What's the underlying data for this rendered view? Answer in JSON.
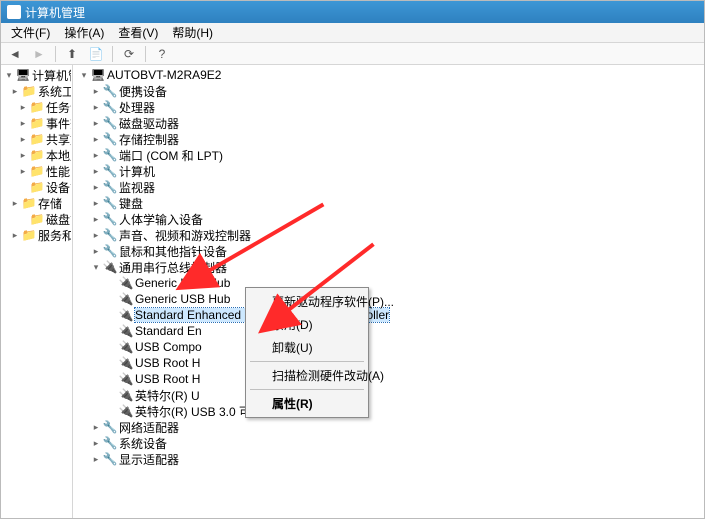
{
  "window": {
    "title": "计算机管理"
  },
  "menu": {
    "file": "文件(F)",
    "action": "操作(A)",
    "view": "查看(V)",
    "help": "帮助(H)"
  },
  "left_tree": {
    "root": "计算机管理(本机",
    "items": [
      "系统工具",
      "任务计划程",
      "事件查看器",
      "共享文件夹",
      "本地用户和",
      "性能",
      "设备管理器",
      "存储",
      "磁盘管理",
      "服务和应用程"
    ]
  },
  "device_tree": {
    "root": "AUTOBVT-M2RA9E2",
    "categories": [
      {
        "label": "便携设备",
        "icon": "portable-device-icon"
      },
      {
        "label": "处理器",
        "icon": "cpu-icon"
      },
      {
        "label": "磁盘驱动器",
        "icon": "disk-icon"
      },
      {
        "label": "存储控制器",
        "icon": "storage-ctrl-icon"
      },
      {
        "label": "端口 (COM 和 LPT)",
        "icon": "port-icon"
      },
      {
        "label": "计算机",
        "icon": "computer-icon"
      },
      {
        "label": "监视器",
        "icon": "monitor-icon"
      },
      {
        "label": "键盘",
        "icon": "keyboard-icon"
      },
      {
        "label": "人体学输入设备",
        "icon": "hid-icon"
      },
      {
        "label": "声音、视频和游戏控制器",
        "icon": "sound-icon"
      },
      {
        "label": "鼠标和其他指针设备",
        "icon": "mouse-icon"
      }
    ],
    "usb_category": "通用串行总线控制器",
    "usb_devices": [
      "Generic USB Hub",
      "Generic USB Hub",
      "Standard Enhanced PCI to USB Host Controller",
      "Standard Enhanced PCI to USB Host Controller",
      "USB Composite Device",
      "USB Root Hub",
      "USB Root Hub",
      "英特尔(R) USB 3.0 可扩展主机控制器",
      "英特尔(R) USB 3.0 可扩展主机控制器"
    ],
    "usb_devices_clipped": [
      "Generic USB Hub",
      "Generic USB Hub",
      "Standard Enhanced PCI to USB Host Controller",
      "Standard En",
      "USB Compo",
      "USB Root H",
      "USB Root H",
      "英特尔(R) U",
      "英特尔(R) USB 3.0 可扩展主机控制器"
    ],
    "usb_devices_suffix": [
      "",
      "",
      "",
      "oller",
      "",
      "",
      "",
      "",
      ""
    ],
    "after_categories": [
      {
        "label": "网络适配器",
        "icon": "network-icon"
      },
      {
        "label": "系统设备",
        "icon": "system-icon"
      },
      {
        "label": "显示适配器",
        "icon": "display-icon"
      }
    ]
  },
  "context_menu": {
    "update_driver": "更新驱动程序软件(P)...",
    "disable": "禁用(D)",
    "uninstall": "卸载(U)",
    "scan_hw": "扫描检测硬件改动(A)",
    "properties": "属性(R)"
  },
  "arrow_color": "#ff2a2a"
}
